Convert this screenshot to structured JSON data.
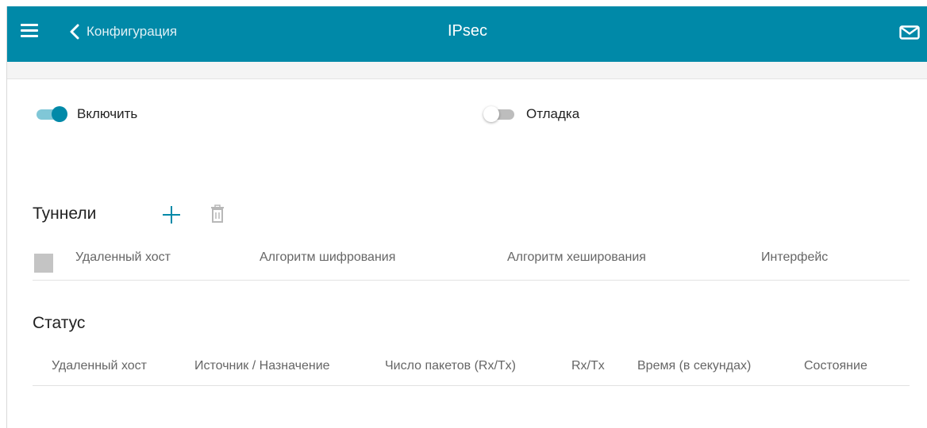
{
  "header": {
    "back_label": "Конфигурация",
    "title": "IPsec",
    "menu_icon": "menu-icon",
    "back_icon": "chevron-left-icon",
    "mail_icon": "mail-icon"
  },
  "toggles": {
    "enable": {
      "label": "Включить",
      "on": true
    },
    "debug": {
      "label": "Отладка",
      "on": false
    }
  },
  "tunnels": {
    "title": "Туннели",
    "add_icon": "plus-icon",
    "delete_icon": "trash-icon",
    "columns": [
      "Удаленный хост",
      "Алгоритм шифрования",
      "Алгоритм хеширования",
      "Интерфейс"
    ],
    "rows": []
  },
  "status": {
    "title": "Статус",
    "columns": [
      "Удаленный хост",
      "Источник / Назначение",
      "Число пакетов (Rx/Tx)",
      "Rx/Tx",
      "Время (в секундах)",
      "Состояние"
    ],
    "rows": []
  },
  "colors": {
    "accent": "#0089a8",
    "toggle_track_on": "#80c7d7",
    "checkbox": "#c4c4c4"
  }
}
